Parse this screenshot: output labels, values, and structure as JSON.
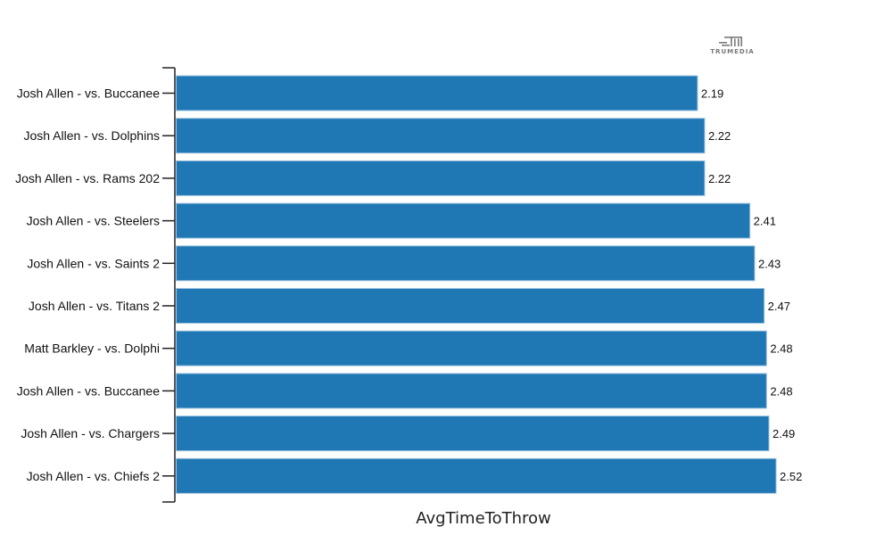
{
  "brand": {
    "logo_text": "TRUMEDIA",
    "logo_icon": "trumedia-logo-icon"
  },
  "colors": {
    "bar": "#1f77b4",
    "bar_edge": "#9ec3df",
    "axis": "#222222"
  },
  "chart_data": {
    "type": "bar",
    "orientation": "horizontal",
    "title": "",
    "xlabel": "AvgTimeToThrow",
    "ylabel": "",
    "xlim": [
      0,
      2.52
    ],
    "grid": false,
    "legend": "none",
    "categories": [
      "Josh Allen - vs. Buccanee",
      "Josh Allen - vs. Dolphins",
      "Josh Allen - vs. Rams 202",
      "Josh Allen - vs. Steelers",
      "Josh Allen - vs. Saints 2",
      "Josh Allen - vs. Titans 2",
      "Matt Barkley - vs. Dolphi",
      "Josh Allen - vs. Buccanee",
      "Josh Allen - vs. Chargers",
      "Josh Allen - vs. Chiefs 2"
    ],
    "values": [
      2.19,
      2.22,
      2.22,
      2.41,
      2.43,
      2.47,
      2.48,
      2.48,
      2.49,
      2.52
    ],
    "value_labels": [
      "2.19",
      "2.22",
      "2.22",
      "2.41",
      "2.43",
      "2.47",
      "2.48",
      "2.48",
      "2.49",
      "2.52"
    ]
  }
}
